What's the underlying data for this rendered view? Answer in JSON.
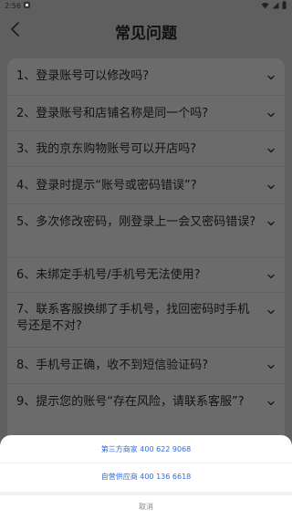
{
  "status_bar": {
    "time": "2:56",
    "notification_icon": "notification-app-icon",
    "icons": [
      "wifi-icon",
      "signal-icon",
      "battery-icon"
    ]
  },
  "header": {
    "title": "常见问题",
    "back_icon": "chevron-left-icon"
  },
  "faq": {
    "items": [
      {
        "question": "1、登录账号可以修改吗?"
      },
      {
        "question": "2、登录账号和店铺名称是同一个吗?"
      },
      {
        "question": "3、我的京东购物账号可以开店吗?"
      },
      {
        "question": "4、登录时提示“账号或密码错误”?"
      },
      {
        "question": "5、多次修改密码，刚登录上一会又密码错误?"
      },
      {
        "question": "6、未绑定手机号/手机号无法使用?"
      },
      {
        "question": "7、联系客服换绑了手机号，找回密码时手机号还是不对?"
      },
      {
        "question": "8、手机号正确，收不到短信验证码?"
      },
      {
        "question": "9、提示您的账号“存在风险，请联系客服”?"
      }
    ]
  },
  "action_sheet": {
    "options": [
      {
        "label": "第三方商家 400 622 9068"
      },
      {
        "label": "自营供应商 400 136 6618"
      }
    ],
    "cancel_label": "取消"
  },
  "colors": {
    "overlay": "#5f5f5f",
    "card": "#6b6b6b",
    "link": "#2f6de1",
    "sheet_bg": "#ffffff"
  }
}
